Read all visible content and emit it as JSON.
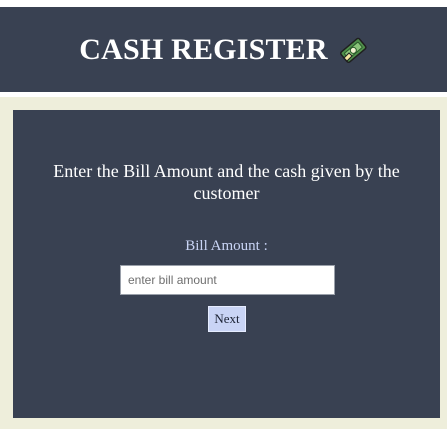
{
  "header": {
    "title": "CASH REGISTER",
    "icon": "money-icon"
  },
  "main": {
    "instruction": "Enter the Bill Amount and the cash given by the customer",
    "bill_label": "Bill Amount :",
    "bill_input": {
      "value": "",
      "placeholder": "enter bill amount"
    },
    "next_label": "Next"
  },
  "colors": {
    "panel_bg": "#394152",
    "frame_bg": "#eeeedb",
    "label_text": "#c9d4f5",
    "button_bg": "#c9d4f5",
    "title_text": "#ffffff"
  }
}
